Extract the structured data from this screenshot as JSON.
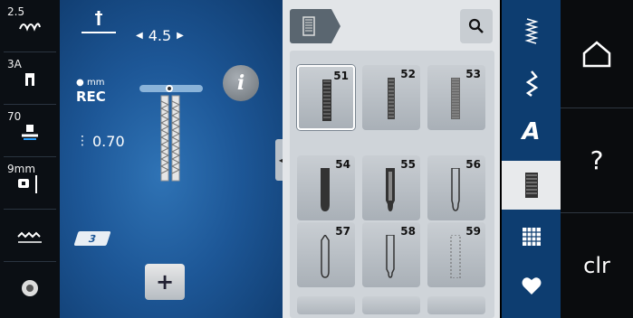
{
  "left_sidebar": {
    "stitch_length": "2.5",
    "thread_tension": "3A",
    "presser_pressure": "70",
    "needle_size": "9mm"
  },
  "main": {
    "width_value": "4.5",
    "rec_top": "mm",
    "rec_label": "REC",
    "length_value": "0.70",
    "add_label": "+",
    "info_label": "i",
    "foot_label": "3"
  },
  "panel": {
    "tiles": [
      {
        "num": "51"
      },
      {
        "num": "52"
      },
      {
        "num": "53"
      },
      {
        "num": "54"
      },
      {
        "num": "55"
      },
      {
        "num": "56"
      },
      {
        "num": "57"
      },
      {
        "num": "58"
      },
      {
        "num": "59"
      }
    ]
  },
  "right_bar": {
    "help_label": "?",
    "clear_label": "clr"
  },
  "colors": {
    "accent": "#1d5797",
    "panel": "#e2e5e8",
    "tab_active": "#e8eaec"
  }
}
